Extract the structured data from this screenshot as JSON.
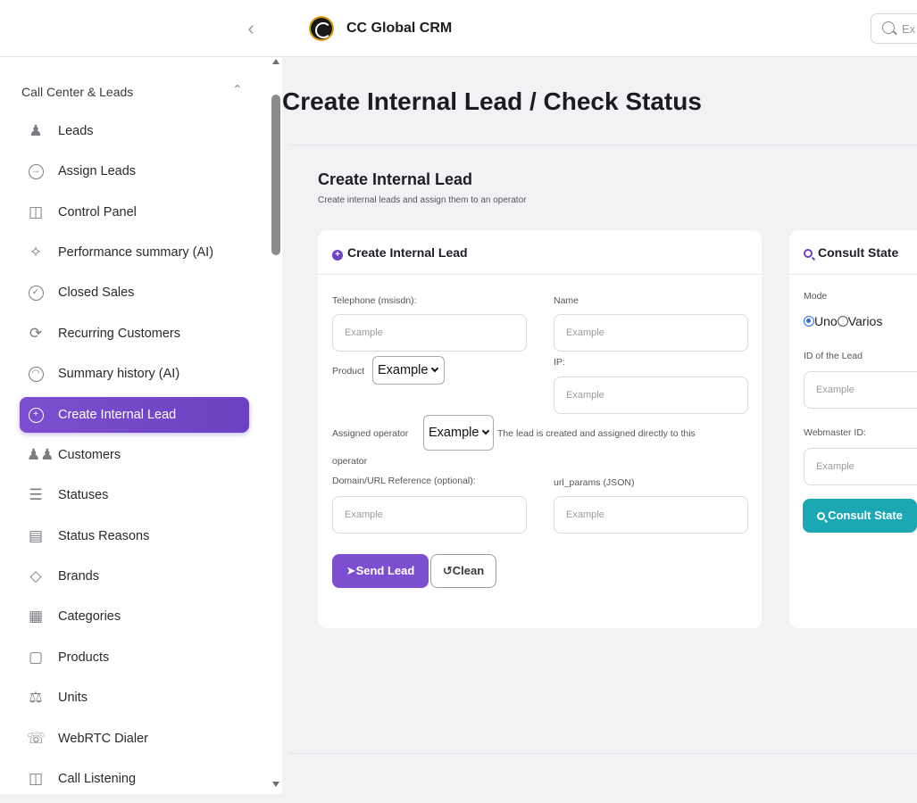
{
  "header": {
    "app_title": "CC Global CRM",
    "search_placeholder": "Ex"
  },
  "sidebar": {
    "section_title": "Call Center & Leads",
    "items": [
      {
        "label": "Leads",
        "icon": "user-plus-icon"
      },
      {
        "label": "Assign Leads",
        "icon": "arrow-circle-icon"
      },
      {
        "label": "Control Panel",
        "icon": "columns-icon"
      },
      {
        "label": "Performance summary (AI)",
        "icon": "sparkles-icon"
      },
      {
        "label": "Closed Sales",
        "icon": "check-circle-icon"
      },
      {
        "label": "Recurring Customers",
        "icon": "refresh-icon"
      },
      {
        "label": "Summary history (AI)",
        "icon": "clock-icon"
      },
      {
        "label": "Create Internal Lead",
        "icon": "plus-circle-icon"
      },
      {
        "label": "Customers",
        "icon": "users-icon"
      },
      {
        "label": "Statuses",
        "icon": "list-icon"
      },
      {
        "label": "Status Reasons",
        "icon": "inbox-icon"
      },
      {
        "label": "Brands",
        "icon": "tag-icon"
      },
      {
        "label": "Categories",
        "icon": "grid-icon"
      },
      {
        "label": "Products",
        "icon": "bag-icon"
      },
      {
        "label": "Units",
        "icon": "scale-icon"
      },
      {
        "label": "WebRTC Dialer",
        "icon": "phone-icon"
      },
      {
        "label": "Call Listening",
        "icon": "radio-icon"
      }
    ],
    "active_item": "Create Internal Lead"
  },
  "main": {
    "page_title": "Create Internal Lead / Check Status",
    "section_title": "Create Internal Lead",
    "section_subtitle": "Create internal leads and assign them to an operator",
    "create_card": {
      "title": "Create Internal Lead",
      "telephone_label": "Telephone (msisdn):",
      "telephone_placeholder": "Example",
      "name_label": "Name",
      "name_placeholder": "Example",
      "product_label": "Product",
      "product_value": "Example",
      "ip_label": "IP:",
      "ip_placeholder": "Example",
      "operator_label": "Assigned operator",
      "operator_value": "Example",
      "operator_note_1": "The lead is created and assigned directly to this",
      "operator_note_2": "operator",
      "domain_label": "Domain/URL Reference (optional):",
      "domain_placeholder": "Example",
      "url_params_label": "url_params (JSON)",
      "url_params_placeholder": "Example",
      "send_button": "Send Lead",
      "clean_button": "Clean"
    },
    "consult_card": {
      "title": "Consult State",
      "mode_label": "Mode",
      "mode_uno": "Uno",
      "mode_varios": "Varios",
      "lead_id_label": "ID of the Lead",
      "lead_id_placeholder": "Example",
      "webmaster_label": "Webmaster ID:",
      "webmaster_placeholder": "Example",
      "consult_button": "Consult State"
    }
  },
  "colors": {
    "accent": "#7b4fd0",
    "teal": "#1ba8b4"
  }
}
